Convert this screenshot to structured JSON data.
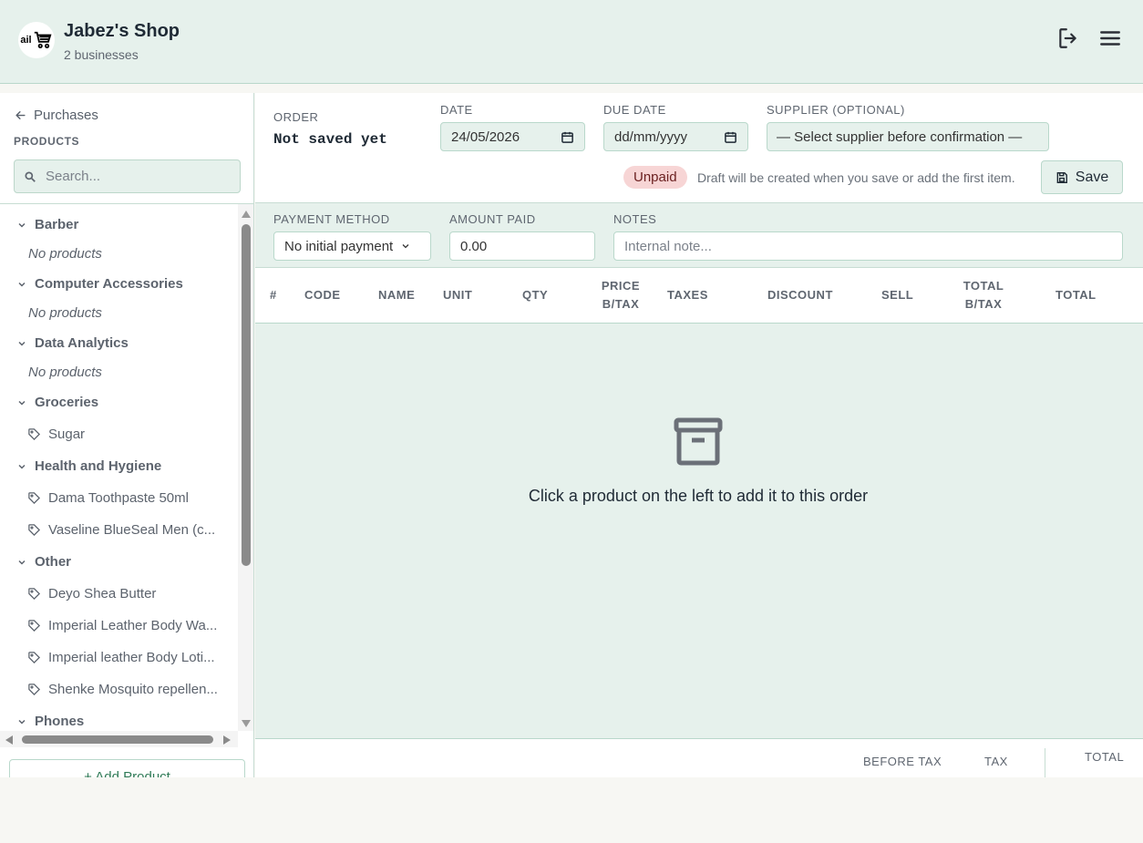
{
  "header": {
    "logo_text": "ail",
    "title": "Jabez's Shop",
    "subtitle": "2 businesses",
    "logout_icon": "logout-icon",
    "menu_icon": "hamburger-menu-icon"
  },
  "sidebar": {
    "back_label": "Purchases",
    "section_label": "PRODUCTS",
    "search_placeholder": "Search...",
    "categories": [
      {
        "name": "Barber",
        "empty_text": "No products"
      },
      {
        "name": "Computer Accessories",
        "empty_text": "No products"
      },
      {
        "name": "Data Analytics",
        "empty_text": "No products"
      },
      {
        "name": "Groceries",
        "products": [
          "Sugar"
        ]
      },
      {
        "name": "Health and Hygiene",
        "products": [
          "Dama Toothpaste 50ml",
          "Vaseline BlueSeal Men (c..."
        ]
      },
      {
        "name": "Other",
        "products": [
          "Deyo Shea Butter",
          "Imperial Leather Body Wa...",
          "Imperial leather Body Loti...",
          "Shenke Mosquito repellen..."
        ]
      },
      {
        "name": "Phones"
      }
    ],
    "add_product_label": "+ Add Product"
  },
  "order": {
    "order_label": "ORDER",
    "order_value": "Not saved yet",
    "date_label": "DATE",
    "date_value": "24/05/2026",
    "due_date_label": "DUE DATE",
    "due_date_value": "dd/mm/yyyy",
    "supplier_label": "SUPPLIER (OPTIONAL)",
    "supplier_value": "— Select supplier before confirmation —",
    "status_badge": "Unpaid",
    "draft_note": "Draft will be created when you save or add the first item.",
    "save_label": "Save"
  },
  "payment": {
    "method_label": "PAYMENT METHOD",
    "method_value": "No initial payment",
    "amount_label": "AMOUNT PAID",
    "amount_value": "0.00",
    "notes_label": "NOTES",
    "notes_placeholder": "Internal note..."
  },
  "table": {
    "columns": [
      "#",
      "CODE",
      "NAME",
      "UNIT",
      "QTY",
      "PRICE B/TAX",
      "TAXES",
      "DISCOUNT",
      "SELL",
      "TOTAL B/TAX",
      "TOTAL"
    ],
    "col_price_line1": "PRICE",
    "col_price_line2": "B/TAX",
    "col_total_btax_line1": "TOTAL",
    "col_total_btax_line2": "B/TAX",
    "empty_message": "Click a product on the left to add it to this order"
  },
  "totals": {
    "before_tax_label": "BEFORE TAX",
    "tax_label": "TAX",
    "total_label": "TOTAL"
  },
  "colors": {
    "accent_bg": "#e6f1ec",
    "border": "#b9d8cb",
    "unpaid_badge": "#f7d5d5",
    "link_green": "#2f7a56"
  }
}
